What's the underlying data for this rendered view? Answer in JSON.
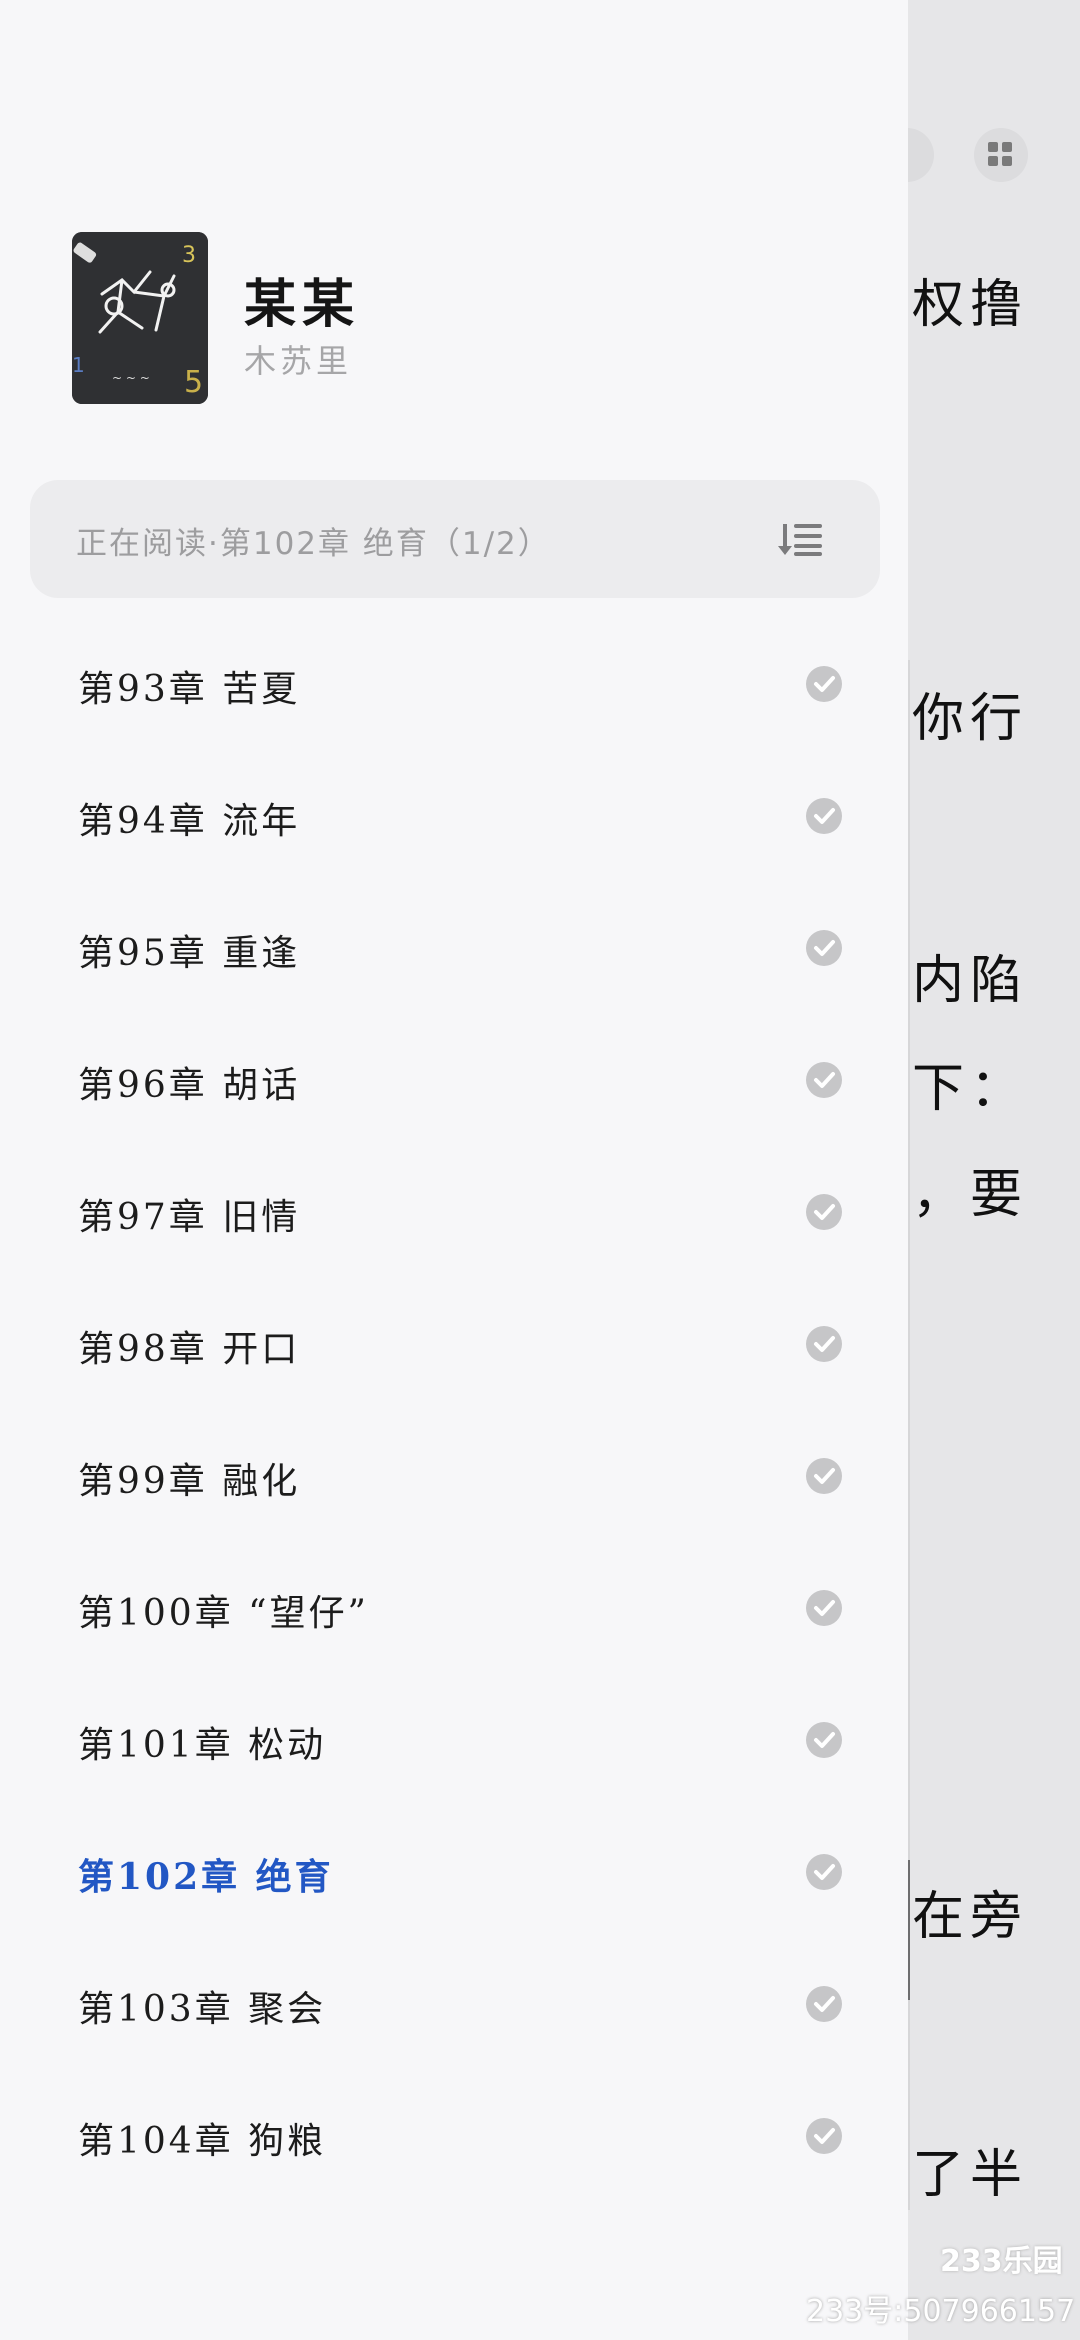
{
  "book": {
    "title": "某某",
    "author": "木苏里"
  },
  "reading_status": "正在阅读·第102章 绝育（1/2）",
  "chapters": [
    {
      "label": "第93章 苦夏",
      "read": true,
      "current": false
    },
    {
      "label": "第94章 流年",
      "read": true,
      "current": false
    },
    {
      "label": "第95章 重逢",
      "read": true,
      "current": false
    },
    {
      "label": "第96章 胡话",
      "read": true,
      "current": false
    },
    {
      "label": "第97章 旧情",
      "read": true,
      "current": false
    },
    {
      "label": "第98章 开口",
      "read": true,
      "current": false
    },
    {
      "label": "第99章 融化",
      "read": true,
      "current": false
    },
    {
      "label": "第100章 “望仔”",
      "read": true,
      "current": false
    },
    {
      "label": "第101章 松动",
      "read": true,
      "current": false
    },
    {
      "label": "第102章 绝育",
      "read": true,
      "current": true
    },
    {
      "label": "第103章 聚会",
      "read": true,
      "current": false
    },
    {
      "label": "第104章 狗粮",
      "read": true,
      "current": false
    }
  ],
  "reader_background": {
    "lines": [
      "权撸",
      "你行",
      "内陷",
      "下：",
      "，要",
      "在旁",
      "了半"
    ]
  },
  "icons": {
    "sort": "sort-list-icon",
    "check": "check-circle-icon",
    "grid": "grid-icon"
  },
  "colors": {
    "current_chapter": "#2257c4",
    "text": "#1c1c1c",
    "muted": "#9d9d9f"
  },
  "watermark": {
    "logo": "233乐园",
    "id": "233号:507966157"
  }
}
